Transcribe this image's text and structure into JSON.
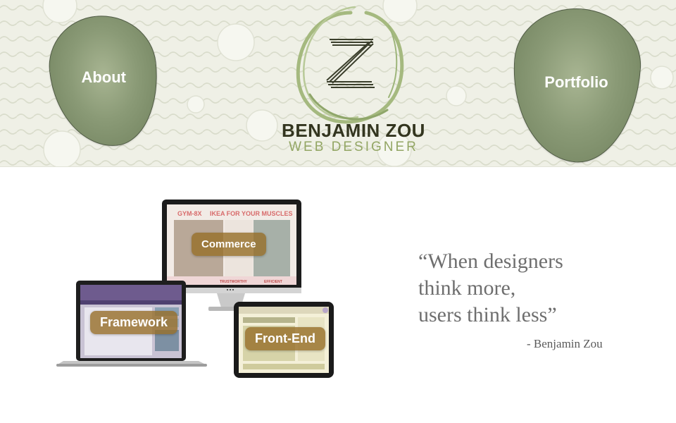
{
  "header": {
    "nav_left_label": "About",
    "nav_right_label": "Portfolio",
    "logo_letter": "Z",
    "brand_name": "BENJAMIN ZOU",
    "brand_tagline": "WEB DESIGNER"
  },
  "showcase": {
    "desktop_brand": "GYM-8X",
    "desktop_headline": "IKEA FOR YOUR MUSCLES",
    "desktop_caption_left": "TRUSTWORTHY",
    "desktop_caption_right": "EFFICIENT",
    "buttons": {
      "commerce": "Commerce",
      "framework": "Framework",
      "frontend": "Front-End"
    }
  },
  "quote": {
    "line1": "“When designers",
    "line2": "think more,",
    "line3": "users think less”",
    "author": "- Benjamin Zou"
  },
  "colors": {
    "header_bg": "#eff0e6",
    "blob_green": "#8a9a76",
    "brand_dark": "#33351f",
    "brand_green": "#93a664",
    "button_bg": "#966e28"
  }
}
